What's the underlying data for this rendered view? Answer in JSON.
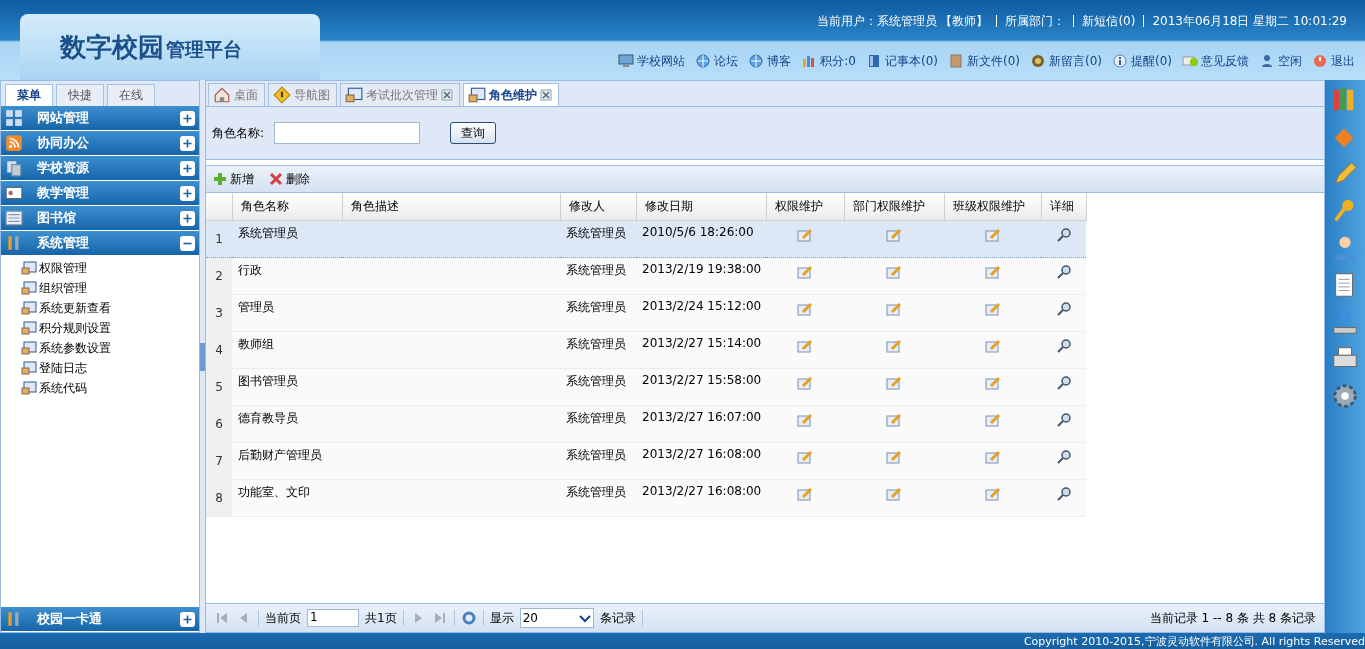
{
  "header": {
    "logo_main": "数字校园",
    "logo_sub": "管理平台",
    "status": [
      "当前用户：系统管理员 【教师】",
      "所属部门：",
      "新短信(0)",
      "2013年06月18日 星期二 10:01:29"
    ],
    "links": [
      "学校网站",
      "论坛",
      "博客",
      "积分:0",
      "记事本(0)",
      "新文件(0)",
      "新留言(0)",
      "提醒(0)",
      "意见反馈",
      "空闲",
      "退出"
    ]
  },
  "sidebar": {
    "tabs": [
      {
        "label": "菜单",
        "selected": true
      },
      {
        "label": "快捷",
        "selected": false
      },
      {
        "label": "在线",
        "selected": false
      }
    ],
    "sections": [
      {
        "title": "网站管理",
        "expanded": false
      },
      {
        "title": "协同办公",
        "expanded": false
      },
      {
        "title": "学校资源",
        "expanded": false
      },
      {
        "title": "教学管理",
        "expanded": false
      },
      {
        "title": "图书馆",
        "expanded": false
      },
      {
        "title": "系统管理",
        "expanded": true,
        "items": [
          "权限管理",
          "组织管理",
          "系统更新查看",
          "积分规则设置",
          "系统参数设置",
          "登陆日志",
          "系统代码"
        ]
      }
    ],
    "bottom_section": {
      "title": "校园一卡通",
      "expanded": false
    }
  },
  "tabs": [
    {
      "label": "桌面",
      "selected": false,
      "closable": false
    },
    {
      "label": "导航图",
      "selected": false,
      "closable": false
    },
    {
      "label": "考试批次管理",
      "selected": false,
      "closable": true
    },
    {
      "label": "角色维护",
      "selected": true,
      "closable": true
    }
  ],
  "search": {
    "label": "角色名称:",
    "button": "查询"
  },
  "toolbar": [
    {
      "label": "新增",
      "kind": "add"
    },
    {
      "label": "删除",
      "kind": "delete"
    }
  ],
  "table": {
    "columns": [
      {
        "label": "角色名称",
        "kind": "text"
      },
      {
        "label": "角色描述",
        "kind": "text"
      },
      {
        "label": "修改人",
        "kind": "text"
      },
      {
        "label": "修改日期",
        "kind": "text"
      },
      {
        "label": "权限维护",
        "kind": "edit"
      },
      {
        "label": "部门权限维护",
        "kind": "edit"
      },
      {
        "label": "班级权限维护",
        "kind": "edit"
      },
      {
        "label": "详细",
        "kind": "detail"
      }
    ],
    "rows": [
      {
        "index": "1",
        "name": "系统管理员",
        "modifier": "系统管理员",
        "date": "2010/5/6 18:26:00",
        "selected": true
      },
      {
        "index": "2",
        "name": "行政",
        "modifier": "系统管理员",
        "date": "2013/2/19 19:38:00",
        "selected": false
      },
      {
        "index": "3",
        "name": "管理员",
        "modifier": "系统管理员",
        "date": "2013/2/24 15:12:00",
        "selected": false
      },
      {
        "index": "4",
        "name": "教师组",
        "modifier": "系统管理员",
        "date": "2013/2/27 15:14:00",
        "selected": false
      },
      {
        "index": "5",
        "name": "图书管理员",
        "modifier": "系统管理员",
        "date": "2013/2/27 15:58:00",
        "selected": false
      },
      {
        "index": "6",
        "name": "德育教导员",
        "modifier": "系统管理员",
        "date": "2013/2/27 16:07:00",
        "selected": false
      },
      {
        "index": "7",
        "name": "后勤财产管理员",
        "modifier": "系统管理员",
        "date": "2013/2/27 16:08:00",
        "selected": false
      },
      {
        "index": "8",
        "name": "功能室、文印",
        "modifier": "系统管理员",
        "date": "2013/2/27 16:08:00",
        "selected": false
      }
    ]
  },
  "pager": {
    "page_label": "当前页",
    "page": "1",
    "total": "共1页",
    "show_label": "显示",
    "page_size": "20",
    "size_suffix": "条记录",
    "summary": "当前记录 1 -- 8 条 共 8 条记录"
  },
  "footer": {
    "copyright": "Copyright 2010-2015,宁波灵动软件有限公司. All rights Reserved"
  }
}
